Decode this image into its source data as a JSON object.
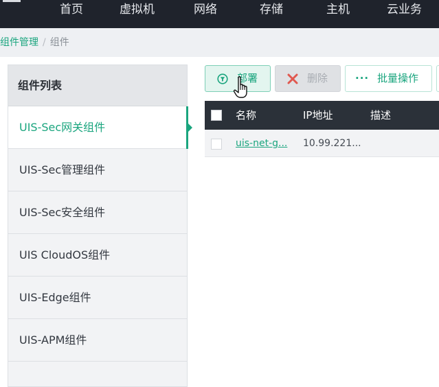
{
  "top_nav": {
    "items": [
      "首页",
      "虚拟机",
      "网络",
      "存储",
      "主机",
      "云业务"
    ]
  },
  "breadcrumb": {
    "parent": "组件管理",
    "separator": "/",
    "current": "组件"
  },
  "component_list": {
    "title": "组件列表",
    "items": [
      "UIS-Sec网关组件",
      "UIS-Sec管理组件",
      "UIS-Sec安全组件",
      "UIS CloudOS组件",
      "UIS-Edge组件",
      "UIS-APM组件"
    ],
    "active_index": 0
  },
  "toolbar": {
    "deploy_label": "部署",
    "delete_label": "删除",
    "batch_label": "批量操作",
    "batch_icon_text": "···"
  },
  "table": {
    "headers": [
      "名称",
      "IP地址",
      "描述"
    ],
    "rows": [
      {
        "name": "uis-net-g...",
        "ip": "10.99.221...",
        "description": ""
      }
    ]
  },
  "colors": {
    "accent": "#1aa57e",
    "topbar": "#1f232c",
    "table_header": "#2b3139",
    "delete_icon": "#e0584f"
  },
  "icons": {
    "menu": "hamburger-icon",
    "deploy": "filter-circle-icon",
    "delete": "close-x-icon",
    "batch": "ellipsis-icon",
    "cursor": "hand-pointer-icon"
  }
}
